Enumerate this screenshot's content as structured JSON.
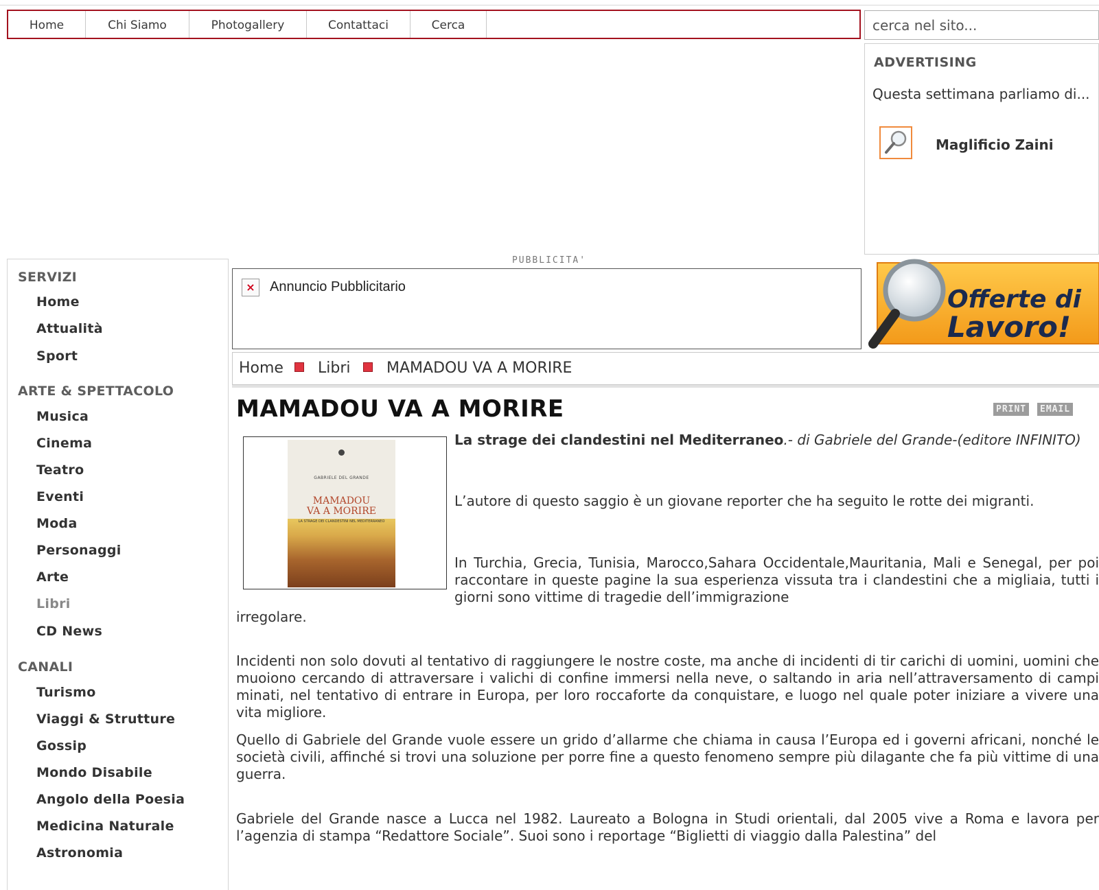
{
  "nav": {
    "items": [
      "Home",
      "Chi Siamo",
      "Photogallery",
      "Contattaci",
      "Cerca"
    ]
  },
  "search": {
    "placeholder": "cerca nel sito..."
  },
  "advertising": {
    "title": "ADVERTISING",
    "text": "Questa settimana parliamo di...",
    "company": "Maglificio Zaini"
  },
  "sidebar": {
    "sections": [
      {
        "title": "SERVIZI",
        "links": [
          "Home",
          "Attualità",
          "Sport"
        ]
      },
      {
        "title": "ARTE & SPETTACOLO",
        "links": [
          "Musica",
          "Cinema",
          "Teatro",
          "Eventi",
          "Moda",
          "Personaggi",
          "Arte",
          "Libri",
          "CD News"
        ]
      },
      {
        "title": "CANALI",
        "links": [
          "Turismo",
          "Viaggi & Strutture",
          "Gossip",
          "Mondo Disabile",
          "Angolo della Poesia",
          "Medicina Naturale",
          "Astronomia"
        ]
      }
    ],
    "active": "Libri"
  },
  "ad": {
    "label": "PUBBLICITA'",
    "banner_alt": "Annuncio Pubblicitario",
    "promo_line1": "Offerte di",
    "promo_line2": "Lavoro!"
  },
  "breadcrumb": [
    "Home",
    "Libri",
    "MAMADOU VA A MORIRE"
  ],
  "article": {
    "title": "MAMADOU VA A MORIRE",
    "print_label": "PRINT",
    "email_label": "EMAIL",
    "book_cover": {
      "author": "GABRIELE DEL GRANDE",
      "title_line1": "MAMADOU",
      "title_line2": "VA A MORIRE",
      "subtitle": "LA STRAGE DEI CLANDESTINI NEL MEDITERRANEO"
    },
    "intro_bold": "La strage dei clandestini nel Mediterraneo",
    "intro_italic": ".- di Gabriele del Grande-(editore INFINITO)",
    "paragraphs": [
      "L’autore di questo saggio è un giovane reporter che ha seguito le rotte dei migranti.",
      "In Turchia, Grecia, Tunisia, Marocco,Sahara Occidentale,Mauritania, Mali e Senegal, per poi raccontare in queste pagine la sua esperienza vissuta tra i clandestini che a migliaia, tutti i giorni sono vittime di tragedie dell’immigrazione",
      "irregolare.",
      "Incidenti non solo dovuti al tentativo di raggiungere le nostre coste, ma anche di incidenti di tir carichi di uomini, uomini che muoiono cercando di attraversare i valichi di confine immersi nella neve, o saltando in aria nell’attraversamento di campi minati, nel tentativo di entrare in Europa, per loro roccaforte da conquistare, e luogo nel quale poter iniziare a vivere una vita migliore.",
      "Quello di Gabriele del Grande vuole essere un grido d’allarme che chiama in causa l’Europa ed i governi africani, nonché le società civili, affinché si trovi una soluzione per porre fine a questo fenomeno sempre più dilagante che fa più vittime di una guerra.",
      "Gabriele del Grande nasce a Lucca nel 1982. Laureato a Bologna in Studi orientali, dal 2005 vive a Roma e lavora per l’agenzia di stampa “Redattore Sociale”. Suoi sono i reportage “Biglietti di viaggio dalla Palestina” del"
    ]
  }
}
